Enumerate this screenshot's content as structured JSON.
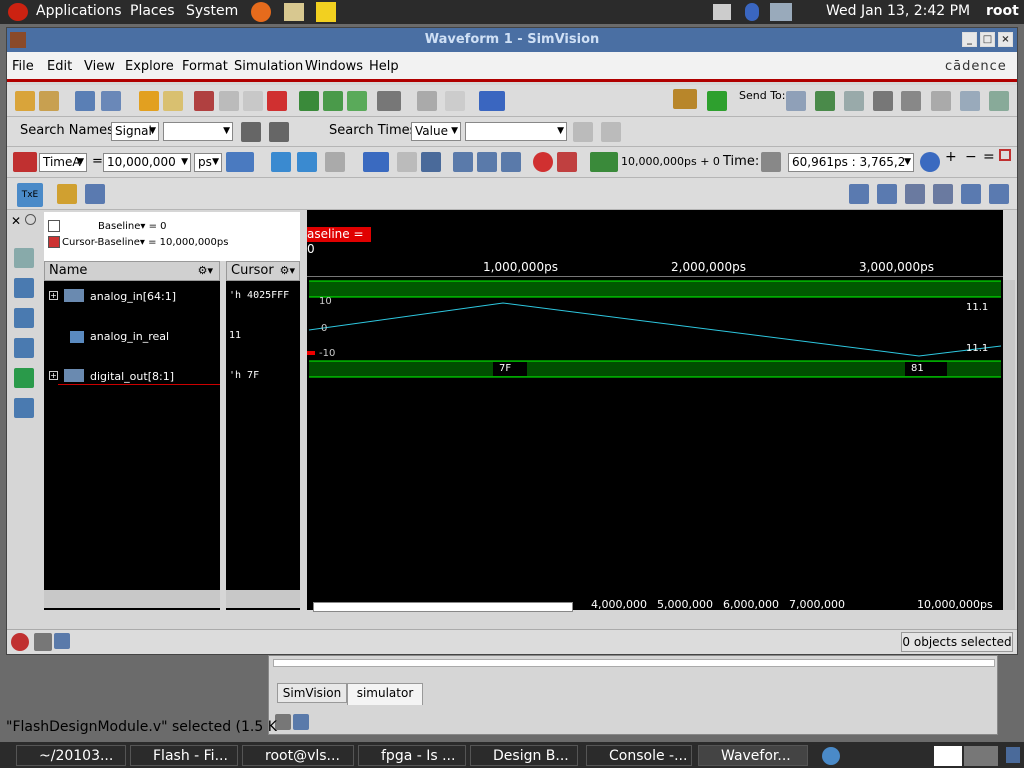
{
  "gnome_panel": {
    "applications": "Applications",
    "places": "Places",
    "system": "System",
    "clock": "Wed Jan 13,  2:42 PM",
    "user": "root"
  },
  "window": {
    "title": "Waveform 1 - SimVision"
  },
  "menu": {
    "file": "File",
    "edit": "Edit",
    "view": "View",
    "explore": "Explore",
    "format": "Format",
    "simulation": "Simulation",
    "windows": "Windows",
    "help": "Help",
    "brand": "cādence"
  },
  "toolbar1": {
    "send_to": "Send To:"
  },
  "search": {
    "names_label": "Search Names:",
    "names_type": "Signal",
    "times_label": "Search Times:",
    "times_type": "Value"
  },
  "cursorbar": {
    "cursor_name": "TimeA",
    "equals": "=",
    "value": "10,000,000",
    "unit": "ps",
    "stat": "10,000,000ps + 0",
    "time_label": "Time:",
    "time_range": "60,961ps : 3,765,2"
  },
  "namepane": {
    "baseline": "Baseline",
    "baseline_val": "= 0",
    "cursor_baseline": "Cursor-Baseline",
    "cursor_baseline_val": "= 10,000,000ps",
    "col_name": "Name",
    "col_cursor": "Cursor",
    "signals": [
      {
        "name": "analog_in[64:1]",
        "value": "'h 4025FFF"
      },
      {
        "name": "analog_in_real",
        "value": "11"
      },
      {
        "name": "digital_out[8:1]",
        "value": "'h 7F"
      }
    ]
  },
  "wave": {
    "baseline_tag": "aseline = 0",
    "ticks": [
      "1,000,000ps",
      "2,000,000ps",
      "3,000,000ps"
    ],
    "real_top": "10",
    "real_zero": "0",
    "real_bottom": "-10",
    "val_right1": "11.1",
    "val_right2": "11.1",
    "bus_a": "7F",
    "bus_b": "81",
    "ruler": [
      "4,000,000",
      "5,000,000",
      "6,000,000",
      "7,000,000",
      "10,000,000ps"
    ]
  },
  "status": {
    "selected": "0 objects selected"
  },
  "lower": {
    "tab1": "SimVision",
    "tab2": "simulator",
    "message": "\"FlashDesignModule.v\" selected (1.5 K"
  },
  "taskbar": {
    "items": [
      "~/20103...",
      "Flash - Fi...",
      "root@vls...",
      "fpga - Is ...",
      "Design B...",
      "Console -...",
      "Wavefor..."
    ]
  }
}
